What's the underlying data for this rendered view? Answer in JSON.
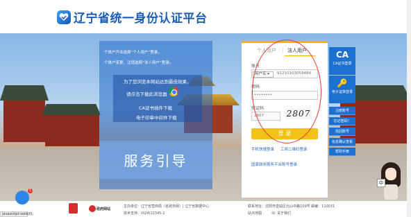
{
  "header": {
    "logo_text": "辽宁省统一身份认证平台"
  },
  "left_panel": {
    "lines": [
      "个体户开业选择“个人用户”登录，",
      "个体户变更、注销选择“法人用户”登录。"
    ],
    "notice_lines": [
      "为了您浏览本网站达到最佳效果，",
      "请点击下载此浏览器",
      "CA证书插件下载",
      "电子印章中间件下载"
    ],
    "service_guide": "服务引导"
  },
  "login": {
    "tabs": {
      "personal": "个人用户",
      "separator": "|",
      "legal": "法人用户"
    },
    "account_label": "账号",
    "account_type": "用户名 ▾",
    "account_value": "91210103059484",
    "password_label": "密码",
    "password_value": "••••••••",
    "captcha_label": "验证码",
    "captcha_value": "2807",
    "captcha_image_text": "2807",
    "login_button": "登 录",
    "links": {
      "phone_login": "手机快捷登录",
      "ukey_login": "工商二维码登录",
      "national_account": "国家政务服务平台账号登录"
    }
  },
  "sidebar": {
    "ca_login": "CA证书登录",
    "seal_login": "电子证章登录",
    "register": "注册账号",
    "forgot": "忘记密码？",
    "find_account": "找回账号",
    "guide": "信息确认查看",
    "help": "帮助手册",
    "ca_icon_text": "CA"
  },
  "footer": {
    "host": "主办单位：辽宁省营商局（省政务网）| 辽宁省数据中心",
    "phone_support": "技术支持：(024)12345-2",
    "address": "联系地址：沈阳市皇姑区北山中路109号   邮编：110031",
    "site_map": "站点地图",
    "contact_us": "关于我们",
    "gov_site": "政府网站"
  },
  "mascot": {
    "bubble": "中"
  },
  "status": {
    "url": "javascript:void(0);",
    "bird_badge": "1"
  }
}
